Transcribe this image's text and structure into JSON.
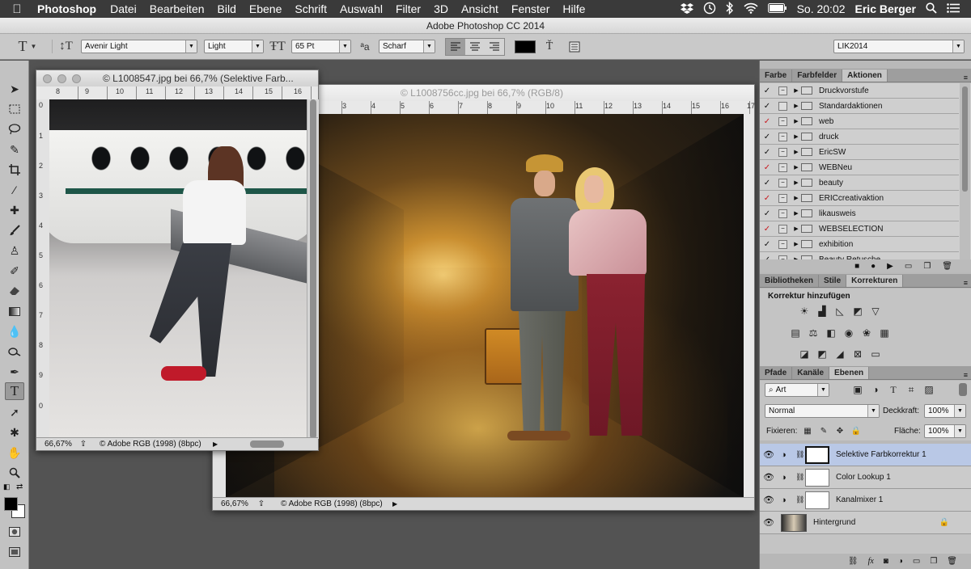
{
  "menubar": {
    "app": "Photoshop",
    "items": [
      "Datei",
      "Bearbeiten",
      "Bild",
      "Ebene",
      "Schrift",
      "Auswahl",
      "Filter",
      "3D",
      "Ansicht",
      "Fenster",
      "Hilfe"
    ],
    "clock": "So. 20:02",
    "user": "Eric Berger"
  },
  "window": {
    "title": "Adobe Photoshop CC 2014"
  },
  "options": {
    "tool_glyph": "T",
    "font_family": "Avenir Light",
    "font_style": "Light",
    "font_size": "65 Pt",
    "aa_glyph": "ªa",
    "antialias": "Scharf",
    "workspace": "LIK2014",
    "text_color": "#000000"
  },
  "doc1": {
    "title": "© L1008547.jpg bei 66,7% (Selektive Farb...",
    "ruler_h": [
      "8",
      "9",
      "10",
      "11",
      "12",
      "13",
      "14",
      "15",
      "16"
    ],
    "ruler_v": [
      "0",
      "1",
      "2",
      "3",
      "4",
      "5",
      "6",
      "7",
      "8",
      "9",
      "0"
    ],
    "zoom": "66,67%",
    "profile": "© Adobe RGB (1998) (8bpc)"
  },
  "doc2": {
    "title": "© L1008756cc.jpg bei 66,7% (RGB/8)",
    "ruler_h": [
      "3",
      "4",
      "5",
      "6",
      "7",
      "8",
      "9",
      "10",
      "11",
      "12",
      "13",
      "14",
      "15",
      "16",
      "17"
    ],
    "zoom": "66,67%",
    "profile": "© Adobe RGB (1998) (8bpc)"
  },
  "panel_top": {
    "tabs": [
      "Farbe",
      "Farbfelder",
      "Aktionen"
    ],
    "actions": [
      {
        "name": "Druckvorstufe",
        "red": false
      },
      {
        "name": "Standardaktionen",
        "red": false
      },
      {
        "name": "web",
        "red": true
      },
      {
        "name": "druck",
        "red": false
      },
      {
        "name": "EricSW",
        "red": false
      },
      {
        "name": "WEBNeu",
        "red": true
      },
      {
        "name": "beauty",
        "red": false
      },
      {
        "name": "ERICcreativaktion",
        "red": true
      },
      {
        "name": "likausweis",
        "red": false
      },
      {
        "name": "WEBSELECTION",
        "red": true
      },
      {
        "name": "exhibition",
        "red": false
      },
      {
        "name": "Beauty Retusche",
        "red": false
      }
    ]
  },
  "panel_mid": {
    "tabs": [
      "Bibliotheken",
      "Stile",
      "Korrekturen"
    ],
    "heading": "Korrektur hinzufügen"
  },
  "panel_layers": {
    "tabs": [
      "Pfade",
      "Kanäle",
      "Ebenen"
    ],
    "filter": "Art",
    "blend_mode": "Normal",
    "opacity_label": "Deckkraft:",
    "opacity": "100%",
    "lock_label": "Fixieren:",
    "fill_label": "Fläche:",
    "fill": "100%",
    "layers": [
      {
        "name": "Selektive Farbkorrektur 1",
        "selected": true
      },
      {
        "name": "Color Lookup 1",
        "selected": false
      },
      {
        "name": "Kanalmixer 1",
        "selected": false
      },
      {
        "name": "Hintergrund",
        "selected": false
      }
    ]
  }
}
